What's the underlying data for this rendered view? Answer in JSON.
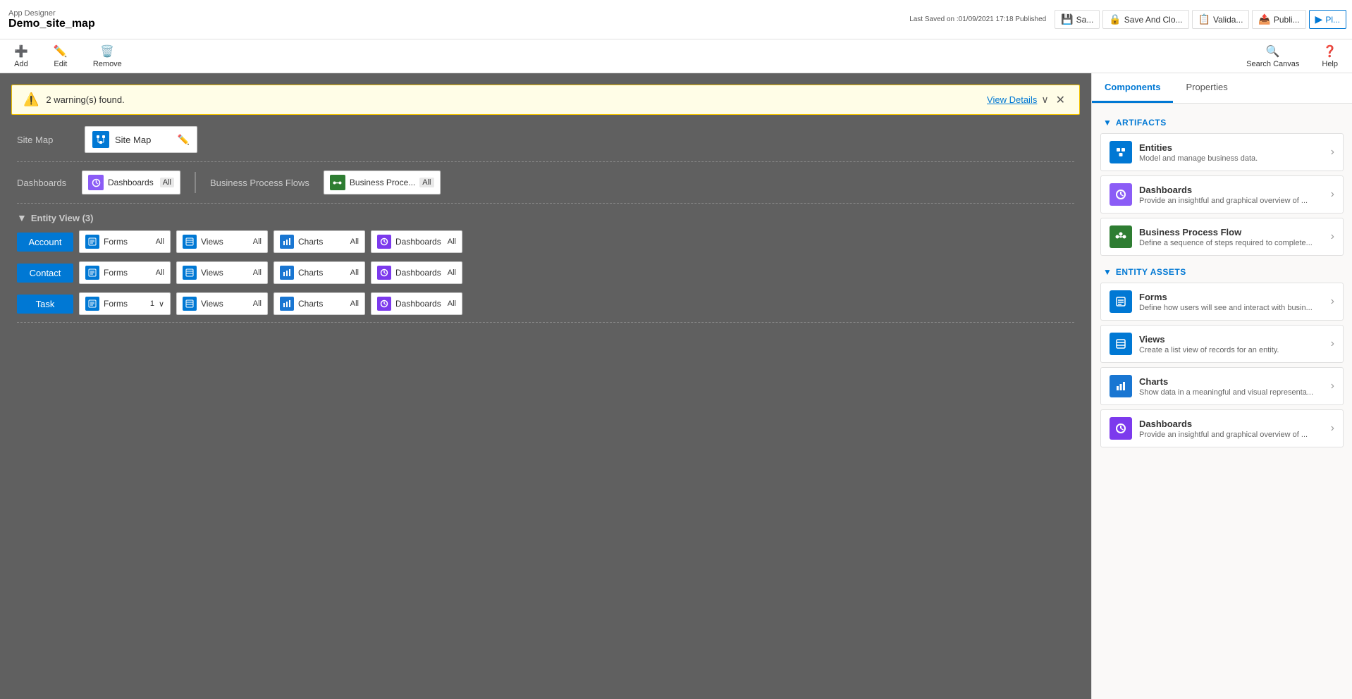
{
  "appTitle": "App Designer",
  "appName": "Demo_site_map",
  "saveInfo": "Last Saved on :01/09/2021 17:18 Published",
  "toolbar": {
    "save_label": "Sa...",
    "saveAndClose_label": "Save And Clo...",
    "validate_label": "Valida...",
    "publish_label": "Publi...",
    "playthrough_label": "Pl...",
    "add_label": "Add",
    "edit_label": "Edit",
    "remove_label": "Remove",
    "searchCanvas_label": "Search Canvas",
    "help_label": "Help"
  },
  "warning": {
    "message": "2 warning(s) found.",
    "viewDetails": "View Details"
  },
  "canvas": {
    "siteMap": {
      "label": "Site Map",
      "cardName": "Site Map"
    },
    "dashboards": {
      "label": "Dashboards",
      "card": {
        "name": "Dashboards",
        "badge": "All"
      },
      "bpfLabel": "Business Process Flows",
      "bpfCard": {
        "name": "Business Proce...",
        "badge": "All"
      }
    },
    "entityView": {
      "title": "Entity View (3)",
      "entities": [
        {
          "name": "Account",
          "assets": [
            {
              "type": "Forms",
              "badge": "All",
              "icon": "forms"
            },
            {
              "type": "Views",
              "badge": "All",
              "icon": "views"
            },
            {
              "type": "Charts",
              "badge": "All",
              "icon": "charts"
            },
            {
              "type": "Dashboards",
              "badge": "All",
              "icon": "dashboards"
            }
          ]
        },
        {
          "name": "Contact",
          "assets": [
            {
              "type": "Forms",
              "badge": "All",
              "icon": "forms"
            },
            {
              "type": "Views",
              "badge": "All",
              "icon": "views"
            },
            {
              "type": "Charts",
              "badge": "All",
              "icon": "charts"
            },
            {
              "type": "Dashboards",
              "badge": "All",
              "icon": "dashboards"
            }
          ]
        },
        {
          "name": "Task",
          "assets": [
            {
              "type": "Forms",
              "badge": "1",
              "icon": "forms",
              "hasDropdown": true
            },
            {
              "type": "Views",
              "badge": "All",
              "icon": "views"
            },
            {
              "type": "Charts",
              "badge": "All",
              "icon": "charts"
            },
            {
              "type": "Dashboards",
              "badge": "All",
              "icon": "dashboards"
            }
          ]
        }
      ]
    }
  },
  "rightPanel": {
    "tabs": [
      "Components",
      "Properties"
    ],
    "activeTab": "Components",
    "artifacts": {
      "title": "ARTIFACTS",
      "items": [
        {
          "name": "Entities",
          "desc": "Model and manage business data.",
          "icon": "comp-blue"
        },
        {
          "name": "Dashboards",
          "desc": "Provide an insightful and graphical overview of ...",
          "icon": "comp-purple"
        },
        {
          "name": "Business Process Flow",
          "desc": "Define a sequence of steps required to complete...",
          "icon": "comp-green"
        }
      ]
    },
    "entityAssets": {
      "title": "ENTITY ASSETS",
      "items": [
        {
          "name": "Forms",
          "desc": "Define how users will see and interact with busin...",
          "icon": "comp-blue"
        },
        {
          "name": "Views",
          "desc": "Create a list view of records for an entity.",
          "icon": "comp-blue"
        },
        {
          "name": "Charts",
          "desc": "Show data in a meaningful and visual representa...",
          "icon": "comp-chart"
        },
        {
          "name": "Dashboards",
          "desc": "Provide an insightful and graphical overview of ...",
          "icon": "comp-dash"
        }
      ]
    }
  },
  "colors": {
    "accent": "#0078d4",
    "warning": "#f0c000",
    "entityBtn": "#0078d4",
    "formsIcon": "#0078d4",
    "viewsIcon": "#0078d4",
    "chartsIcon": "#1976d2",
    "dashboardsIcon": "#7c3aed"
  }
}
